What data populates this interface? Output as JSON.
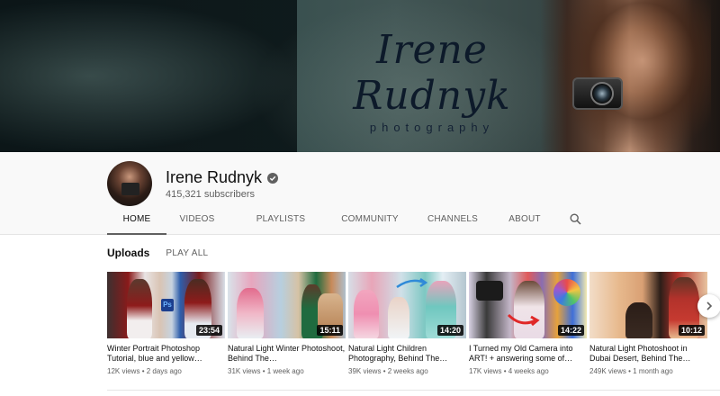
{
  "banner": {
    "brand_script": "Irene Rudnyk",
    "brand_sub": "photography"
  },
  "channel": {
    "name": "Irene Rudnyk",
    "subscribers": "415,321 subscribers",
    "verified": true
  },
  "tabs": [
    {
      "label": "HOME",
      "active": true
    },
    {
      "label": "VIDEOS",
      "active": false
    },
    {
      "label": "PLAYLISTS",
      "active": false
    },
    {
      "label": "COMMUNITY",
      "active": false
    },
    {
      "label": "CHANNELS",
      "active": false
    },
    {
      "label": "ABOUT",
      "active": false
    }
  ],
  "search_icon": "search-icon",
  "uploads": {
    "title": "Uploads",
    "play_all": "PLAY ALL",
    "videos": [
      {
        "title": "Winter Portrait Photoshop Tutorial, blue and yellow…",
        "duration": "23:54",
        "views": "12K views",
        "age": "2 days ago"
      },
      {
        "title": "Natural Light Winter Photoshoot, Behind The…",
        "duration": "15:11",
        "views": "31K views",
        "age": "1 week ago"
      },
      {
        "title": "Natural Light Children Photography, Behind The…",
        "duration": "14:20",
        "views": "39K views",
        "age": "2 weeks ago"
      },
      {
        "title": "I Turned my Old Camera into ART! + answering some of…",
        "duration": "14:22",
        "views": "17K views",
        "age": "4 weeks ago"
      },
      {
        "title": "Natural Light Photoshoot in Dubai Desert, Behind The…",
        "duration": "10:12",
        "views": "249K views",
        "age": "1 month ago"
      }
    ]
  },
  "colors": {
    "active_tab_underline": "#606060",
    "header_bg": "#f9f9f9",
    "meta_text": "#606060"
  }
}
